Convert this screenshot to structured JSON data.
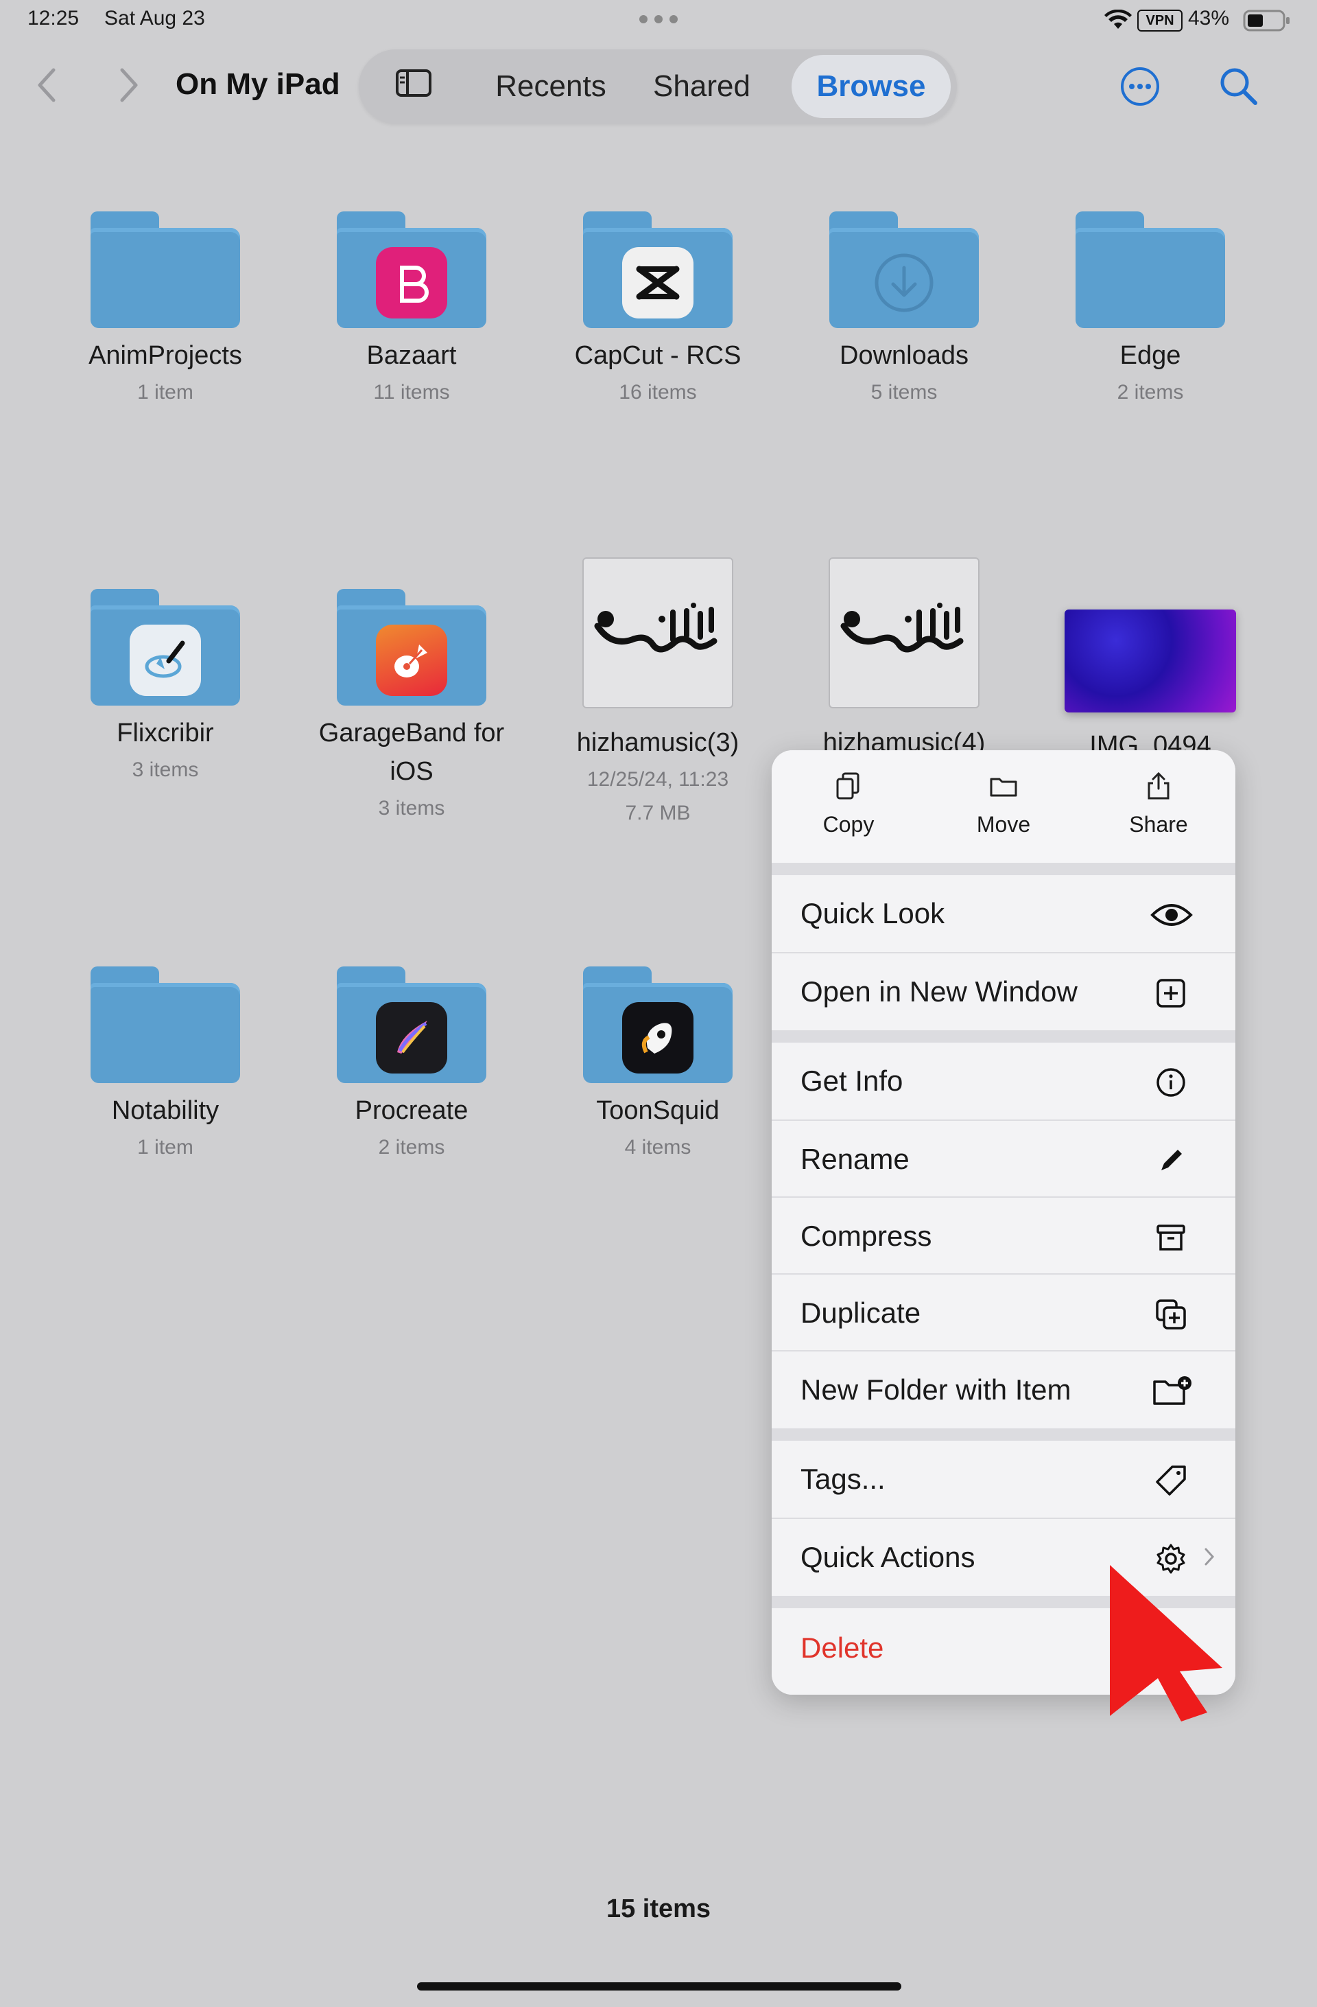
{
  "status_bar": {
    "time": "12:25",
    "date": "Sat Aug 23",
    "vpn": "VPN",
    "battery": "43%"
  },
  "nav": {
    "title": "On My iPad",
    "tabs": [
      "Recents",
      "Shared",
      "Browse"
    ],
    "active_tab": "Browse"
  },
  "items": [
    {
      "name": "AnimProjects",
      "meta": "1 item",
      "kind": "folder"
    },
    {
      "name": "Bazaart",
      "meta": "11 items",
      "kind": "folder-app",
      "badge_color": "#e0207a"
    },
    {
      "name": "CapCut - RCS",
      "meta": "16 items",
      "kind": "folder-app",
      "badge_color": "#f0f0f0"
    },
    {
      "name": "Downloads",
      "meta": "5 items",
      "kind": "folder-download"
    },
    {
      "name": "Edge",
      "meta": "2 items",
      "kind": "folder"
    },
    {
      "name": "Flixcribir",
      "meta": "3 items",
      "kind": "folder-app",
      "badge_color": "#e9eef3"
    },
    {
      "name": "GarageBand for iOS",
      "name_line1": "GarageBand for",
      "name_line2": "iOS",
      "meta": "3 items",
      "kind": "folder-app",
      "badge_color": "#f06030"
    },
    {
      "name": "hizhamusic(3)",
      "meta": "12/25/24, 11:23",
      "meta2": "7.7 MB",
      "kind": "image"
    },
    {
      "name": "hizhamusic(4)",
      "meta": "",
      "kind": "image"
    },
    {
      "name": "IMG_0494",
      "meta": "",
      "kind": "photo"
    },
    {
      "name": "Notability",
      "meta": "1 item",
      "kind": "folder"
    },
    {
      "name": "Procreate",
      "meta": "2 items",
      "kind": "folder-app",
      "badge_color": "#1b1b1f"
    },
    {
      "name": "ToonSquid",
      "meta": "4 items",
      "kind": "folder-app",
      "badge_color": "#111115"
    }
  ],
  "menu": {
    "top_actions": [
      "Copy",
      "Move",
      "Share"
    ],
    "rows": [
      {
        "label": "Quick Look",
        "icon": "eye-icon"
      },
      {
        "label": "Open in New Window",
        "icon": "plus-square-icon"
      },
      {
        "label": "Get Info",
        "icon": "info-icon"
      },
      {
        "label": "Rename",
        "icon": "pencil-icon"
      },
      {
        "label": "Compress",
        "icon": "archive-icon"
      },
      {
        "label": "Duplicate",
        "icon": "duplicate-icon"
      },
      {
        "label": "New Folder with Item",
        "icon": "folder-plus-icon"
      },
      {
        "label": "Tags...",
        "icon": "tag-icon"
      },
      {
        "label": "Quick Actions",
        "icon": "gear-icon"
      },
      {
        "label": "Delete",
        "icon": ""
      }
    ],
    "delete_color": "#e0342b"
  },
  "footer": {
    "count": "15 items"
  }
}
